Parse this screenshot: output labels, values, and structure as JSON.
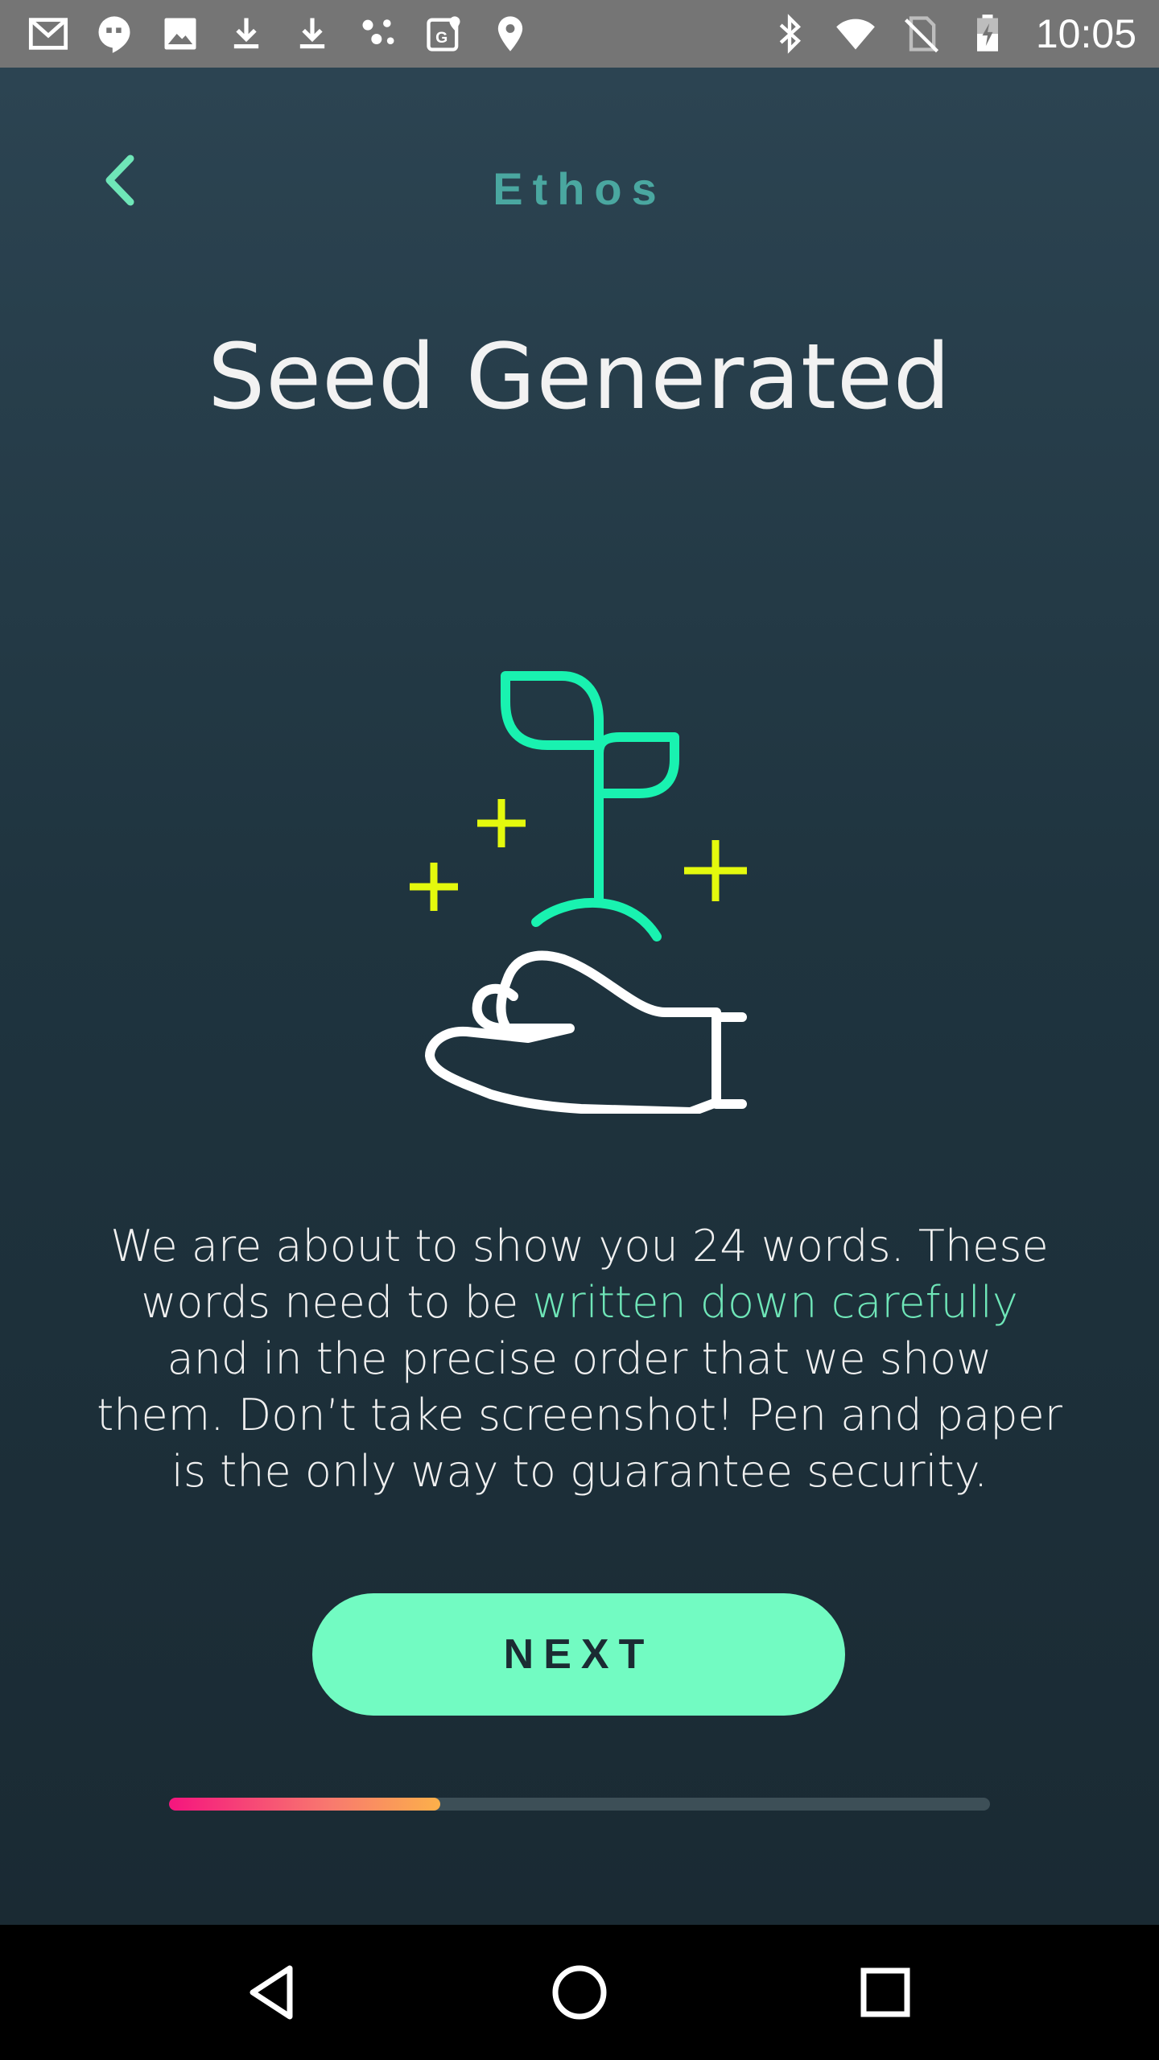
{
  "status_bar": {
    "time": "10:05",
    "left_icons": [
      "gmail-icon",
      "hangouts-icon",
      "photos-icon",
      "download-icon",
      "download-icon",
      "dots-icon",
      "maps-icon",
      "location-pin-icon"
    ],
    "right_icons": [
      "bluetooth-icon",
      "wifi-icon",
      "no-sim-icon",
      "battery-icon"
    ]
  },
  "header": {
    "app_title": "Ethos",
    "back_icon": "chevron-left-icon"
  },
  "main": {
    "heading": "Seed Generated",
    "illustration": "hand-holding-seedling-icon",
    "body_before": "We are about to show you 24 words. These words need to be ",
    "body_highlight": "written down carefully",
    "body_after": " and in the precise order that we show them. Don’t take screenshot! Pen and paper is the only way to guarantee security.",
    "next_label": "NEXT",
    "progress_fraction": 0.33
  },
  "colors": {
    "accent": "#72fbc2",
    "title": "#4aa7a0",
    "highlight": "#6fe6b8",
    "sparkle": "#e4f90d",
    "progress_start": "#f5157e",
    "progress_end": "#fcb04a"
  },
  "nav_bar": {
    "back": "triangle-back-icon",
    "home": "circle-home-icon",
    "recents": "square-recents-icon"
  }
}
